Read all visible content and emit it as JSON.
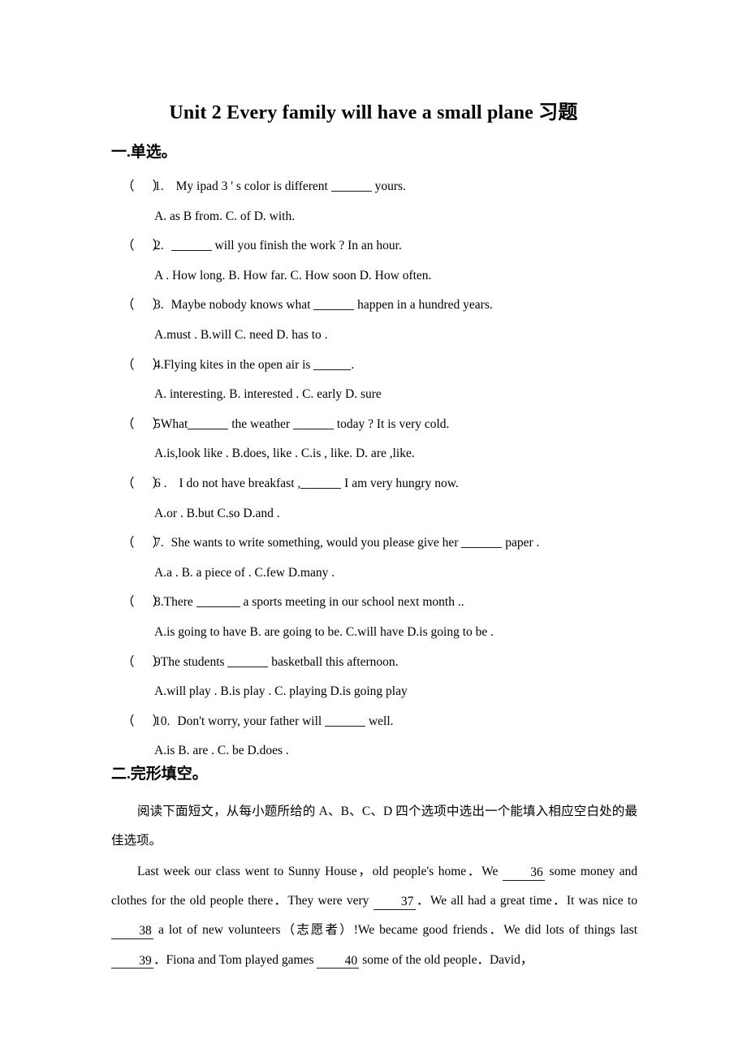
{
  "document": {
    "title": "Unit 2 Every family will have a small plane 习题"
  },
  "sections": {
    "multiple_choice": {
      "heading": "一.单选。",
      "questions": [
        {
          "number": "1.",
          "stem_before": "My   ipad   3 ' s color is different ",
          "stem_after": " yours.",
          "options": "A. as        B from.         C. of         D. with."
        },
        {
          "number": "2.",
          "stem_before": "",
          "stem_after": " will you finish the work ?    In an hour.",
          "options": "A . How   long.    B. How far.    C. How soon    D. How often."
        },
        {
          "number": "3.",
          "stem_before": "Maybe nobody knows what ",
          "stem_after": " happen in a hundred years.",
          "options": "A.must   .    B.will     C. need   D. has to ."
        },
        {
          "number": "4.",
          "stem_before": "Flying kites in the open air is   ",
          "stem_after": ".",
          "options": "A. interesting.    B. interested .    C. early   D. sure"
        },
        {
          "number": "5",
          "stem_before": "What",
          "stem_middle": " the weather ",
          "stem_after": " today ?   It is very cold.",
          "options": "A.is,look like .    B.does, like .     C.is , like. D. are ,like."
        },
        {
          "number": "6 .",
          "stem_before": "I   do not have breakfast ,",
          "stem_after": "   I am very hungry now.",
          "options": "A.or .    B.but    C.so   D.and ."
        },
        {
          "number": "7.",
          "stem_before": "She wants to write something, would you please give her ",
          "stem_after": " paper .",
          "options": "A.a .    B. a piece of .    C.few   D.many   ."
        },
        {
          "number": "8.",
          "stem_before": "There ",
          "stem_after": "   a   sports meeting in our   school next month ..",
          "options": "A.is going to have    B. are going   to be.    C.will have D.is going to be ."
        },
        {
          "number": "9",
          "stem_before": "The students ",
          "stem_after": " basketball this afternoon.",
          "options": "A.will play   .    B.is play .    C. playing   D.is going play"
        },
        {
          "number": "10.",
          "stem_before": "Don't   worry, your father will ",
          "stem_after": " well.",
          "options": "A.is     B. are .    C. be   D.does ."
        }
      ],
      "paren_open": "（",
      "paren_close": "）"
    },
    "cloze": {
      "heading": "二.完形填空。",
      "instructions": "阅读下面短文，从每小题所给的 A、B、C、D 四个选项中选出一个能填入相应空白处的最佳选项。",
      "passage": {
        "part1": "Last week our class went to Sunny House，old people's home．We ",
        "blank36": "36",
        "part2": " some money and clothes for the old people there．They were very ",
        "blank37": "37",
        "part3": "．We all had a great time．It was nice to ",
        "blank38": "38",
        "part4": " a lot of new volunteers（志愿者）!We became good friends．We did lots of things last ",
        "blank39": "39",
        "part5": "．Fiona and Tom played games ",
        "blank40": "40",
        "part6": " some of the old people．David，"
      }
    }
  }
}
